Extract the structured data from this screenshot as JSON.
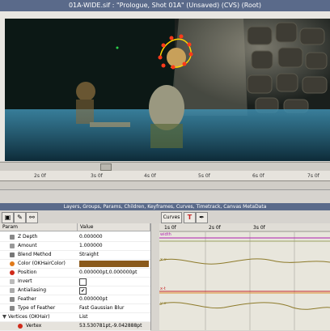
{
  "window": {
    "title": "01A-WIDE.sif : \"Prologue, Shot 01A\" (Unsaved) (CVS) (Root)"
  },
  "timeline": {
    "ticks": [
      "2s 0f",
      "3s 0f",
      "4s 0f",
      "5s 0f",
      "6s 0f",
      "7s 0f"
    ]
  },
  "panels": {
    "header": "Layers, Groups, Params, Children, Keyframes, Curves, Timetrack, Canvas MetaData"
  },
  "params": {
    "col_param": "Param",
    "col_value": "Value",
    "rows": [
      {
        "name": "Z Depth",
        "value": "0.000000"
      },
      {
        "name": "Amount",
        "value": "1.000000"
      },
      {
        "name": "Blend Method",
        "value": "Straight"
      },
      {
        "name": "Color (OKHairColor)",
        "value": ""
      },
      {
        "name": "Position",
        "value": "0.000000pt,0.000000pt"
      },
      {
        "name": "Invert",
        "value": ""
      },
      {
        "name": "Antialiasing",
        "value": "✔"
      },
      {
        "name": "Feather",
        "value": "0.000000pt"
      },
      {
        "name": "Type of Feather",
        "value": "Fast Gaussian Blur"
      },
      {
        "name": "Vertices (OKHair)",
        "value": "List"
      },
      {
        "name": "Vertex",
        "value": "53.530781pt,-9.042888pt"
      }
    ]
  },
  "curves": {
    "tab_label": "Curves",
    "ticks": [
      "1s 0f",
      "2s 0f",
      "3s 0f"
    ],
    "labels": [
      "width",
      "x-v",
      "y-v",
      "x-t",
      "y-v"
    ]
  },
  "colors": {
    "hair_color": "#8a5a1c",
    "curve_red": "#c62828",
    "curve_olive": "#8d7a2a"
  }
}
